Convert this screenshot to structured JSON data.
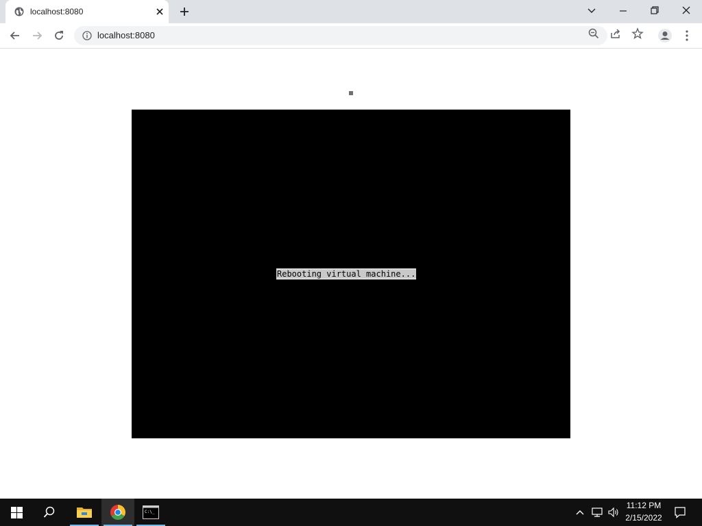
{
  "browser": {
    "tab": {
      "title": "localhost:8080"
    },
    "address_bar": {
      "url": "localhost:8080"
    }
  },
  "vm": {
    "status_text": "Rebooting virtual machine..."
  },
  "taskbar": {
    "clock": {
      "time": "11:12 PM",
      "date": "2/15/2022"
    },
    "pinned": [
      "start-icon",
      "search-icon",
      "file-explorer-icon",
      "chrome-icon",
      "command-prompt-icon"
    ]
  },
  "colors": {
    "tabstrip_bg": "#dee1e6",
    "taskbar_bg": "#101010",
    "vm_screen_bg": "#000000"
  }
}
